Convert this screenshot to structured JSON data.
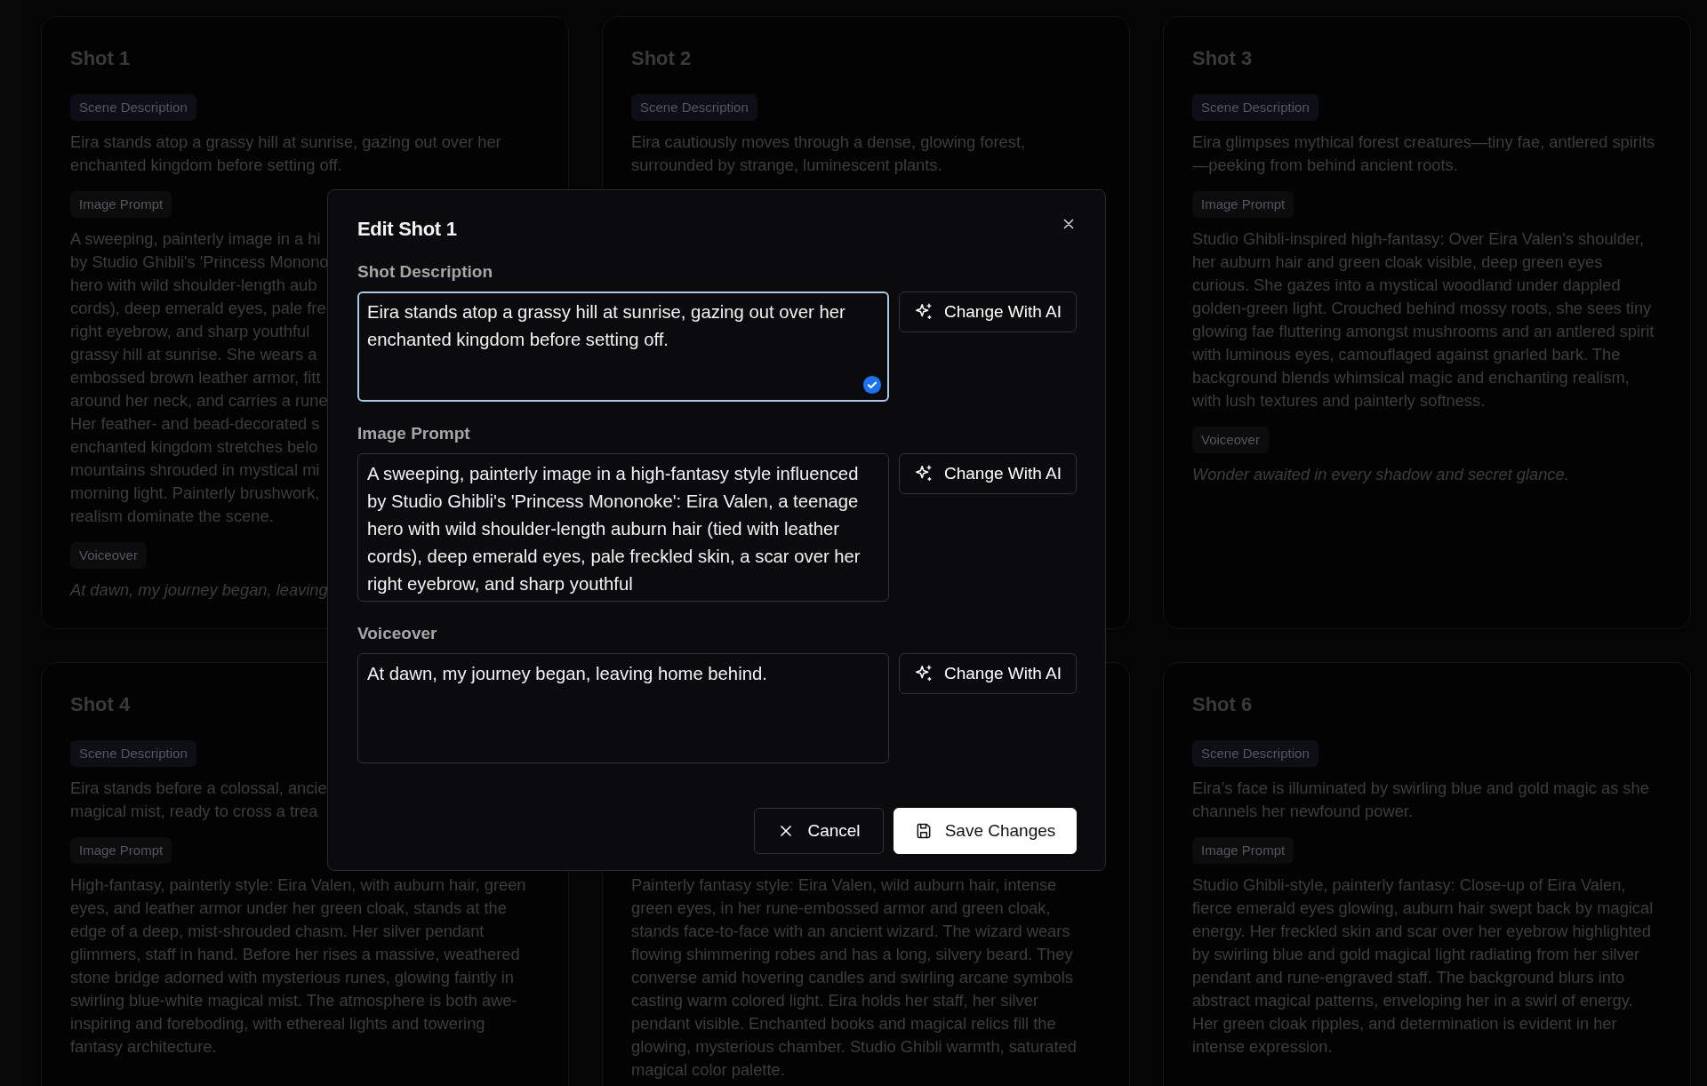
{
  "cards": [
    {
      "title": "Shot 1",
      "sections": [
        {
          "kind": "scene",
          "label": "Scene Description",
          "text": "Eira stands atop a grassy hill at sunrise, gazing out over her enchanted kingdom before setting off."
        },
        {
          "kind": "prompt",
          "label": "Image Prompt",
          "text": "A sweeping, painterly image in a hi\nby Studio Ghibli's 'Princess Monono\nhero with wild shoulder-length aub\ncords), deep emerald eyes, pale fre\nright eyebrow, and sharp youthful\ngrassy hill at sunrise. She wears a\nembossed brown leather armor, fitt\naround her neck, and carries a rune\nHer feather- and bead-decorated s\nenchanted kingdom stretches belo\nmountains shrouded in mystical mi\nmorning light. Painterly brushwork,\nrealism dominate the scene."
        },
        {
          "kind": "voiceover",
          "label": "Voiceover",
          "text": "At dawn, my journey began, leaving"
        }
      ]
    },
    {
      "title": "Shot 2",
      "sections": [
        {
          "kind": "scene",
          "label": "Scene Description",
          "text": "Eira cautiously moves through a dense, glowing forest, surrounded by strange, luminescent plants."
        }
      ]
    },
    {
      "title": "Shot 3",
      "sections": [
        {
          "kind": "scene",
          "label": "Scene Description",
          "text": "Eira glimpses mythical forest creatures—tiny fae, antlered spirits—peeking from behind ancient roots."
        },
        {
          "kind": "prompt",
          "label": "Image Prompt",
          "text": "Studio Ghibli-inspired high-fantasy: Over Eira Valen's shoulder, her auburn hair and green cloak visible, deep green eyes curious. She gazes into a mystical woodland under dappled golden-green light. Crouched behind mossy roots, she sees tiny glowing fae fluttering amongst mushrooms and an antlered spirit with luminous eyes, camouflaged against gnarled bark. The background blends whimsical magic and enchanting realism, with lush textures and painterly softness."
        },
        {
          "kind": "voiceover",
          "label": "Voiceover",
          "text": "Wonder awaited in every shadow and secret glance."
        }
      ]
    },
    {
      "title": "Shot 4",
      "sections": [
        {
          "kind": "scene",
          "label": "Scene Description",
          "text": "Eira stands before a colossal, ancie\nmagical mist, ready to cross a trea"
        },
        {
          "kind": "prompt",
          "label": "Image Prompt",
          "text": "High-fantasy, painterly style: Eira Valen, with auburn hair, green eyes, and leather armor under her green cloak, stands at the edge of a deep, mist-shrouded chasm. Her silver pendant glimmers, staff in hand. Before her rises a massive, weathered stone bridge adorned with mysterious runes, glowing faintly in swirling blue-white magical mist. The atmosphere is both awe-inspiring and foreboding, with ethereal lights and towering fantasy architecture."
        }
      ]
    },
    {
      "sections": [
        {
          "kind": "prompt",
          "text": "Painterly fantasy style: Eira Valen, wild auburn hair, intense green eyes, in her rune-embossed armor and green cloak, stands face-to-face with an ancient wizard. The wizard wears flowing shimmering robes and has a long, silvery beard. They converse amid hovering candles and swirling arcane symbols casting warm colored light. Eira holds her staff, her silver pendant visible. Enchanted books and magical relics fill the glowing, mysterious chamber. Studio Ghibli warmth, saturated magical color palette."
        }
      ]
    },
    {
      "title": "Shot 6",
      "sections": [
        {
          "kind": "scene",
          "label": "Scene Description",
          "text": "Eira’s face is illuminated by swirling blue and gold magic as she channels her newfound power."
        },
        {
          "kind": "prompt",
          "label": "Image Prompt",
          "text": "Studio Ghibli-style, painterly fantasy: Close-up of Eira Valen, fierce emerald eyes glowing, auburn hair swept back by magical energy. Her freckled skin and scar over her eyebrow highlighted by swirling blue and gold magical light radiating from her silver pendant and rune-engraved staff. The background blurs into abstract magical patterns, enveloping her in a swirl of energy. Her green cloak ripples, and determination is evident in her intense expression."
        }
      ]
    }
  ],
  "dialog": {
    "title": "Edit Shot 1",
    "fields": [
      {
        "label": "Shot Description",
        "value": "Eira stands atop a grassy hill at sunrise, gazing out over her enchanted kingdom before setting off.",
        "focused": true,
        "kind": "short",
        "action": "Change With AI"
      },
      {
        "label": "Image Prompt",
        "value": "A sweeping, painterly image in a high-fantasy style influenced by Studio Ghibli's 'Princess Mononoke': Eira Valen, a teenage hero with wild shoulder-length auburn hair (tied with leather cords), deep emerald eyes, pale freckled skin, a scar over her right eyebrow, and sharp youthful",
        "focused": false,
        "kind": "long",
        "action": "Change With AI"
      },
      {
        "label": "Voiceover",
        "value": "At dawn, my journey began, leaving home behind.",
        "focused": false,
        "kind": "short",
        "action": "Change With AI"
      }
    ],
    "buttons": [
      {
        "kind": "cancel",
        "label": "Cancel"
      },
      {
        "kind": "save",
        "label": "Save Changes"
      }
    ]
  }
}
